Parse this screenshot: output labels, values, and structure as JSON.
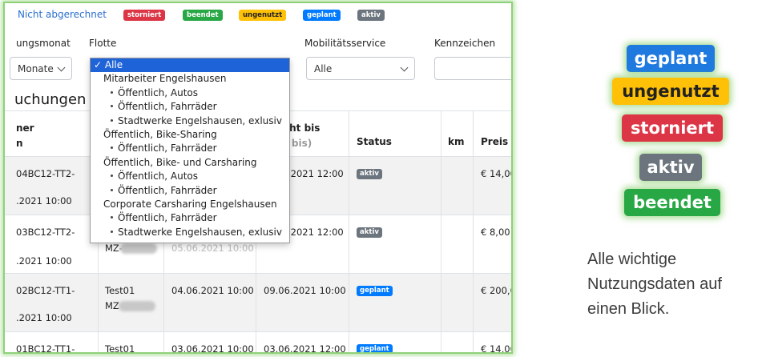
{
  "colors": {
    "primary": "#2a6fcf",
    "danger": "#dc3545",
    "success": "#28a745",
    "warning": "#ffc107",
    "secondary": "#6c757d",
    "glow": "#8fd17a"
  },
  "legend": {
    "link": "Nicht abgerechnet",
    "badges": [
      "storniert",
      "beendet",
      "ungenutzt",
      "geplant",
      "aktiv"
    ]
  },
  "filters": {
    "month_label": "ungsmonat",
    "month_value": "Monate",
    "fleet_label": "Flotte",
    "mobility_label": "Mobilitätsservice",
    "mobility_value": "Alle",
    "plate_label": "Kennzeichen"
  },
  "dropdown": {
    "selected": "✓ Alle",
    "items": [
      {
        "kind": "group",
        "label": "Mitarbeiter Engelshausen"
      },
      {
        "kind": "child",
        "label": "Öffentlich, Autos"
      },
      {
        "kind": "child",
        "label": "Öffentlich, Fahrräder"
      },
      {
        "kind": "child",
        "label": "Stadtwerke Engelshausen, exlusiv"
      },
      {
        "kind": "group",
        "label": "Öffentlich, Bike-Sharing"
      },
      {
        "kind": "child",
        "label": "Öffentlich, Fahrräder"
      },
      {
        "kind": "group",
        "label": "Öffentlich, Bike- und Carsharing"
      },
      {
        "kind": "child",
        "label": "Öffentlich, Autos"
      },
      {
        "kind": "child",
        "label": "Öffentlich, Fahrräder"
      },
      {
        "kind": "group",
        "label": "Corporate Carsharing Engelshausen"
      },
      {
        "kind": "child",
        "label": "Öffentlich, Fahrräder"
      },
      {
        "kind": "child",
        "label": "Stadtwerke Engelshausen, exlusiv"
      }
    ]
  },
  "section_title": "uchungen",
  "table": {
    "headers": {
      "col0_line1": "ner",
      "col0_line2": "n",
      "col3_line1": "cht bis",
      "col3_line2": "t bis)",
      "status": "Status",
      "km": "km",
      "price": "Preis"
    },
    "rows": [
      {
        "id_line1": "04BC12-TT2-",
        "id_line2": ".2021 10:00",
        "user": "",
        "user2": "",
        "from": "",
        "from2": "",
        "to": ".2021 12:00",
        "status": "aktiv",
        "status_color": "#6c757d",
        "km": "",
        "price": "€ 14,00"
      },
      {
        "id_line1": "03BC12-TT2-",
        "id_line2": ".2021 10:00",
        "user": "",
        "user2": "MZ-",
        "from": "",
        "from2": "05.06.2021 10:00",
        "to": ".2021 12:00",
        "status": "aktiv",
        "status_color": "#6c757d",
        "km": "",
        "price": "€ 8,00"
      },
      {
        "id_line1": "02BC12-TT1-",
        "id_line2": ".2021 10:00",
        "user": "Test01",
        "user2": "MZ",
        "from": "04.06.2021 10:00",
        "from2": "",
        "to": "09.06.2021 10:00",
        "status": "geplant",
        "status_color": "#007bff",
        "km": "",
        "price": "€ 200,0"
      },
      {
        "id_line1": "01BC12-TT1-",
        "id_line2": "",
        "user": "Test01",
        "user2": "",
        "from": "03.06.2021 10:00",
        "from2": "",
        "to": "03.06.2021 12:00",
        "status": "geplant",
        "status_color": "#007bff",
        "km": "",
        "price": "€ 14,00"
      }
    ]
  },
  "side_badges": [
    "geplant",
    "ungenutzt",
    "storniert",
    "aktiv",
    "beendet"
  ],
  "tagline": [
    "Alle wichtige",
    "Nutzungsdaten auf",
    "einen Blick."
  ]
}
